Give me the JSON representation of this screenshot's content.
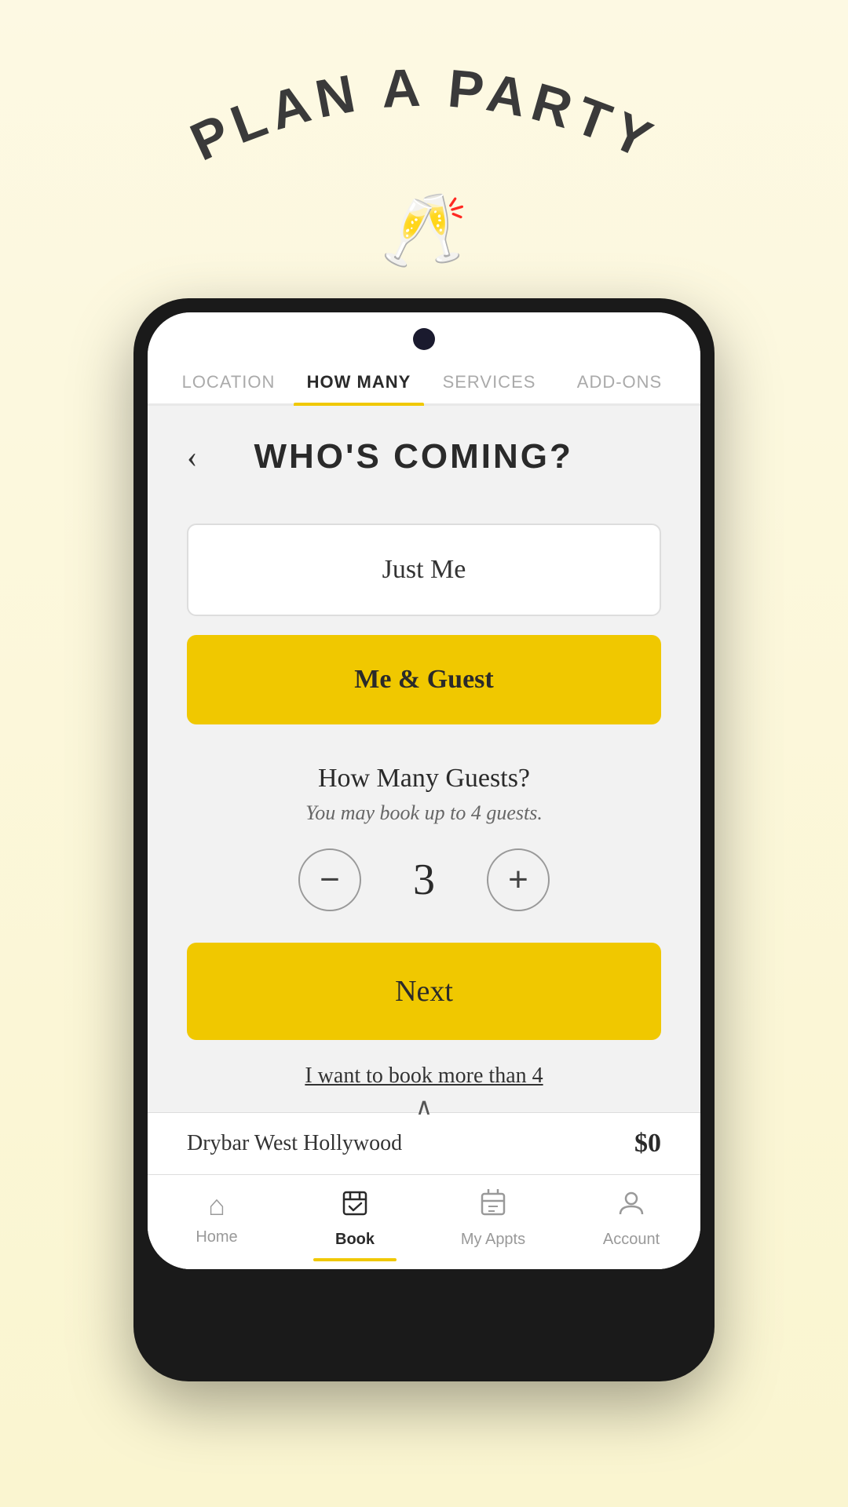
{
  "header": {
    "title": "PLAN A PARTY",
    "champagne_emoji": "🥂"
  },
  "tabs": [
    {
      "id": "location",
      "label": "LOCATION",
      "active": false
    },
    {
      "id": "how_many",
      "label": "HOW MANY",
      "active": true
    },
    {
      "id": "services",
      "label": "SERVICES",
      "active": false
    },
    {
      "id": "add_ons",
      "label": "ADD-ONS",
      "active": false
    }
  ],
  "page": {
    "title": "WHO'S COMING?",
    "back_label": "‹"
  },
  "options": [
    {
      "id": "just_me",
      "label": "Just Me",
      "selected": false
    },
    {
      "id": "me_and_guest",
      "label": "Me & Guest",
      "selected": true
    }
  ],
  "guest_counter": {
    "title": "How Many Guests?",
    "subtitle": "You may book up to 4 guests.",
    "value": 3,
    "decrement_label": "−",
    "increment_label": "+"
  },
  "next_button": {
    "label": "Next"
  },
  "more_link": {
    "label": "I want to book more than 4"
  },
  "bottom_bar": {
    "location": "Drybar West Hollywood",
    "price": "$0",
    "expand_icon": "∧"
  },
  "nav": [
    {
      "id": "home",
      "label": "Home",
      "icon": "⌂",
      "active": false
    },
    {
      "id": "book",
      "label": "Book",
      "icon": "📋",
      "active": true
    },
    {
      "id": "my_appts",
      "label": "My Appts",
      "icon": "📅",
      "active": false
    },
    {
      "id": "account",
      "label": "Account",
      "icon": "👤",
      "active": false
    }
  ],
  "colors": {
    "yellow": "#f0c800",
    "dark": "#2a2a2a",
    "light_bg": "#fdf9e3"
  }
}
